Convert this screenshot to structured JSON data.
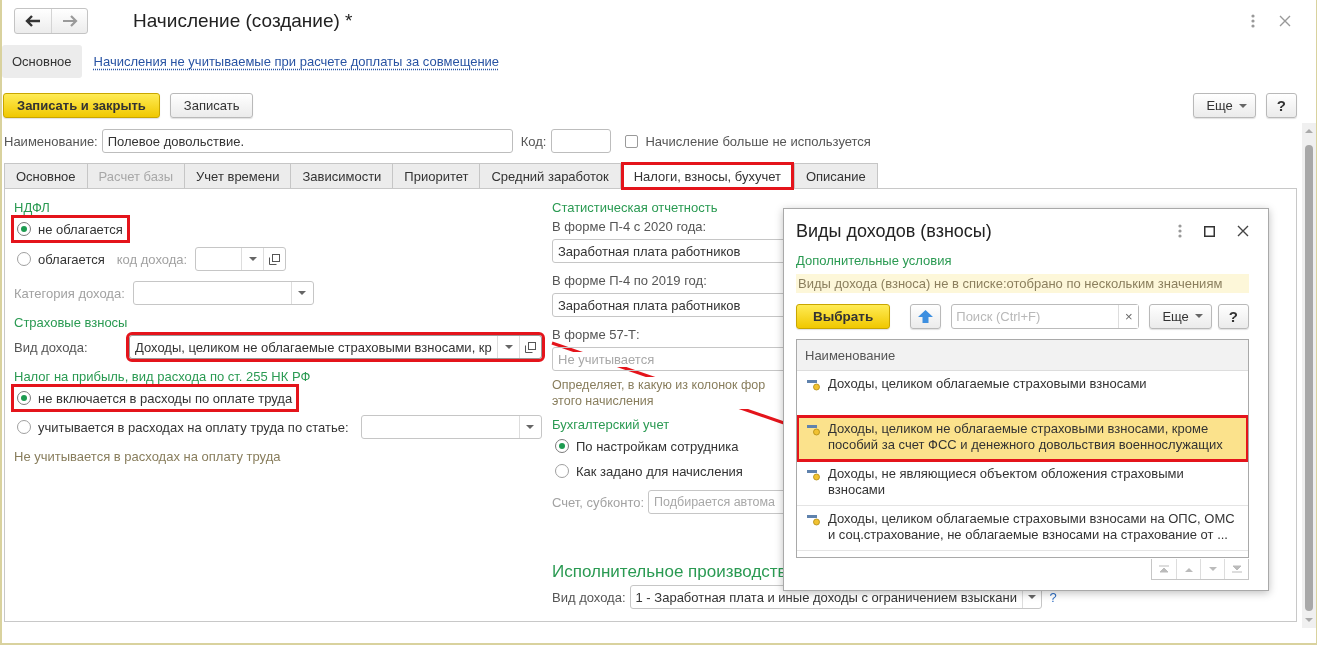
{
  "window": {
    "title": "Начисление (создание) *"
  },
  "sections": [
    {
      "label": "Основное",
      "selected": true
    },
    {
      "label": "Начисления не учитываемые при расчете доплаты за совмещение",
      "selected": false
    }
  ],
  "toolbar": {
    "buttons": [
      {
        "label": "Записать и закрыть",
        "kind": "default"
      },
      {
        "label": "Записать",
        "kind": "normal"
      }
    ],
    "more": "Еще",
    "help": "?"
  },
  "header_fields": {
    "name_label": "Наименование:",
    "name_value": "Полевое довольствие.",
    "code_label": "Код:",
    "unused": {
      "label": "Начисление больше не используется",
      "checked": false
    }
  },
  "tabs": [
    {
      "label": "Основное",
      "selected": false,
      "disabled": false,
      "highlighted": false
    },
    {
      "label": "Расчет базы",
      "selected": false,
      "disabled": true,
      "highlighted": false
    },
    {
      "label": "Учет времени",
      "selected": false,
      "disabled": false,
      "highlighted": false
    },
    {
      "label": "Зависимости",
      "selected": false,
      "disabled": false,
      "highlighted": false
    },
    {
      "label": "Приоритет",
      "selected": false,
      "disabled": false,
      "highlighted": false
    },
    {
      "label": "Средний заработок",
      "selected": false,
      "disabled": false,
      "highlighted": false
    },
    {
      "label": "Налоги, взносы, бухучет",
      "selected": true,
      "disabled": false,
      "highlighted": true
    },
    {
      "label": "Описание",
      "selected": false,
      "disabled": false,
      "highlighted": false
    }
  ],
  "ndfl": {
    "heading": "НДФЛ",
    "options": [
      {
        "label": "не облагается",
        "selected": true,
        "highlighted": true
      },
      {
        "label": "облагается",
        "selected": false,
        "highlighted": false
      }
    ],
    "code_label": "код дохода:",
    "category_label": "Категория дохода:"
  },
  "insurance": {
    "heading": "Страховые взносы",
    "income_label": "Вид дохода:",
    "income_value": "Доходы, целиком не облагаемые страховыми взносами, кр",
    "highlighted": true
  },
  "profit_tax": {
    "heading": "Налог на прибыль, вид расхода по ст. 255 НК РФ",
    "options": [
      {
        "label": "не включается в расходы по оплате труда",
        "selected": true,
        "highlighted": true
      },
      {
        "label": "учитывается в расходах на оплату труда по статье:",
        "selected": false,
        "highlighted": false
      }
    ],
    "note": "Не учитывается в расходах на оплату труда"
  },
  "statistics": {
    "heading": "Статистическая отчетность",
    "fields": [
      {
        "label": "В форме П-4 с 2020 года:",
        "value": "Заработная плата работников"
      },
      {
        "label": "В форме П-4 по 2019 год:",
        "value": "Заработная плата работников"
      },
      {
        "label": "В форме 57-Т:",
        "placeholder": "Не учитывается"
      }
    ],
    "note_lines": [
      "Определяет, в какую из колонок фор",
      "этого начисления"
    ]
  },
  "accounting": {
    "heading": "Бухгалтерский учет",
    "options": [
      {
        "label": "По настройкам сотрудника",
        "selected": true
      },
      {
        "label": "Как задано для начисления",
        "selected": false
      }
    ],
    "account_label": "Счет, субконто:",
    "account_placeholder": "Подбирается автома"
  },
  "enforcement": {
    "heading": "Исполнительное производств",
    "income_label": "Вид дохода:",
    "income_value": "1 - Заработная плата и иные доходы с ограничением взыскани",
    "help": "?"
  },
  "popup": {
    "title": "Виды доходов (взносы)",
    "filter_heading": "Дополнительные условия",
    "filter_text": "Виды дохода (взноса) не в списке:отобрано по нескольким значениям",
    "select_button": "Выбрать",
    "search_placeholder": "Поиск (Ctrl+F)",
    "clear": "×",
    "more": "Еще",
    "help": "?",
    "column": "Наименование",
    "rows": [
      {
        "name": "Доходы, целиком облагаемые страховыми взносами",
        "selected": false,
        "highlighted": false
      },
      {
        "name": "Доходы, целиком не облагаемые страховыми взносами, кроме пособий за счет ФСС и денежного довольствия военнослужащих",
        "selected": true,
        "highlighted": true
      },
      {
        "name": "Доходы, не являющиеся объектом обложения страховыми взносами",
        "selected": false,
        "highlighted": false
      },
      {
        "name": "Доходы, целиком облагаемые страховыми взносами на ОПС, ОМС и соц.страхование, не облагаемые взносами на страхование от ...",
        "selected": false,
        "highlighted": false
      }
    ]
  }
}
